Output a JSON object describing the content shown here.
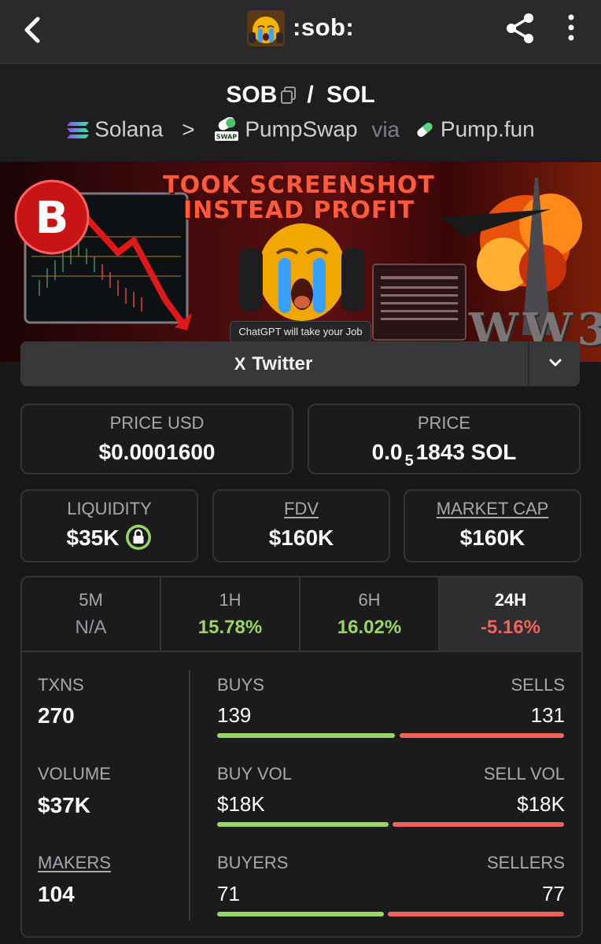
{
  "header": {
    "token_name": ":sob:"
  },
  "pair": {
    "base": "SOB",
    "slash": "/",
    "quote": "SOL",
    "chain": "Solana",
    "chevron": ">",
    "dex": "PumpSwap",
    "via": "via",
    "launchpad": "Pump.fun"
  },
  "banner": {
    "headline_line1": "TOOK SCREENSHOT",
    "headline_line2": "INSTEAD PROFIT",
    "caption": "ChatGPT will take your Job",
    "ww3": "WW3"
  },
  "social": {
    "twitter_label": "Twitter",
    "x_icon": "X"
  },
  "price": {
    "usd_label": "PRICE USD",
    "usd_value": "$0.0001600",
    "native_label": "PRICE",
    "native_prefix": "0.0",
    "native_zeros": "5",
    "native_digits": "1843 SOL"
  },
  "metrics": {
    "liquidity_label": "LIQUIDITY",
    "liquidity_value": "$35K",
    "fdv_label": "FDV",
    "fdv_value": "$160K",
    "mcap_label": "MARKET CAP",
    "mcap_value": "$160K"
  },
  "timeframes": [
    {
      "label": "5M",
      "value": "N/A"
    },
    {
      "label": "1H",
      "value": "15.78%"
    },
    {
      "label": "6H",
      "value": "16.02%"
    },
    {
      "label": "24H",
      "value": "-5.16%"
    }
  ],
  "stats": {
    "txns_label": "TXNS",
    "txns_value": "270",
    "buys_label": "BUYS",
    "buys_value": "139",
    "sells_label": "SELLS",
    "sells_value": "131",
    "volume_label": "VOLUME",
    "volume_value": "$37K",
    "buy_vol_label": "BUY VOL",
    "buy_vol_value": "$18K",
    "sell_vol_label": "SELL VOL",
    "sell_vol_value": "$18K",
    "makers_label": "MAKERS",
    "makers_value": "104",
    "buyers_label": "BUYERS",
    "buyers_value": "71",
    "sellers_label": "SELLERS",
    "sellers_value": "77"
  },
  "colors": {
    "positive": "#9bd561",
    "negative": "#f0645c",
    "background": "#18181b"
  }
}
